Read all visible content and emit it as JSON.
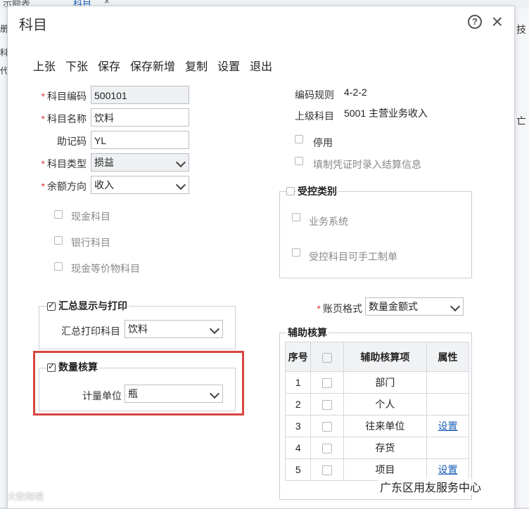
{
  "background": {
    "tab1": "示额表",
    "tab2": "科目",
    "tab_close": "×",
    "left_glyphs": [
      "册",
      "科",
      "代"
    ],
    "right_glyphs": [
      "技",
      "亡"
    ]
  },
  "dialog": {
    "title": "科目"
  },
  "toolbar": {
    "items": [
      "上张",
      "下张",
      "保存",
      "保存新增",
      "复制",
      "设置",
      "退出"
    ]
  },
  "form": {
    "code_label": "科目编码",
    "code_value": "500101",
    "name_label": "科目名称",
    "name_value": "饮料",
    "mnemonic_label": "助记码",
    "mnemonic_value": "YL",
    "type_label": "科目类型",
    "type_value": "损益",
    "balance_label": "余额方向",
    "balance_value": "收入",
    "cash_label": "现金科目",
    "bank_label": "银行科目",
    "cash_equiv_label": "现金等价物科目"
  },
  "right": {
    "rule_label": "编码规则",
    "rule_value": "4-2-2",
    "parent_label": "上级科目",
    "parent_value": "5001 主营业务收入",
    "disable_label": "停用",
    "settle_label": "填制凭证时录入结算信息",
    "controlled_title": "受控类别",
    "biz_label": "业务系统",
    "manual_label": "受控科目可手工制单",
    "page_format_label": "账页格式",
    "page_format_value": "数量金额式"
  },
  "summary": {
    "title": "汇总显示与打印",
    "print_label": "汇总打印科目",
    "print_value": "饮料"
  },
  "quantity": {
    "title": "数量核算",
    "unit_label": "计量单位",
    "unit_value": "瓶"
  },
  "aux": {
    "title": "辅助核算",
    "headers": {
      "no": "序号",
      "item": "辅助核算项",
      "attr": "属性"
    },
    "rows": [
      {
        "no": "1",
        "item": "部门",
        "attr": ""
      },
      {
        "no": "2",
        "item": "个人",
        "attr": ""
      },
      {
        "no": "3",
        "item": "往来单位",
        "attr": "设置"
      },
      {
        "no": "4",
        "item": "存货",
        "attr": ""
      },
      {
        "no": "5",
        "item": "项目",
        "attr": "设置"
      }
    ]
  },
  "watermarks": {
    "left": "大数跨境",
    "right": "广东区用友服务中心"
  }
}
